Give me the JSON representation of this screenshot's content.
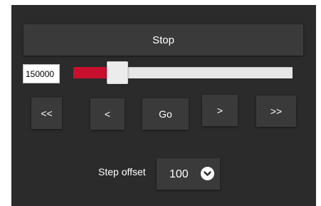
{
  "controls": {
    "stop_label": "Stop",
    "position_value": "150000",
    "slider": {
      "fraction": 0.2,
      "fill_color": "#c8102e",
      "track_color": "#e6e6e6"
    },
    "nav": {
      "fast_back": "<<",
      "back": "<",
      "go": "Go",
      "forward": ">",
      "fast_forward": ">>"
    },
    "step_offset": {
      "label": "Step offset",
      "value": "100",
      "icon": "chevron-down-icon"
    }
  },
  "colors": {
    "panel_background": "#2b2b2b",
    "button_background": "#3a3a3a",
    "accent": "#c8102e"
  }
}
